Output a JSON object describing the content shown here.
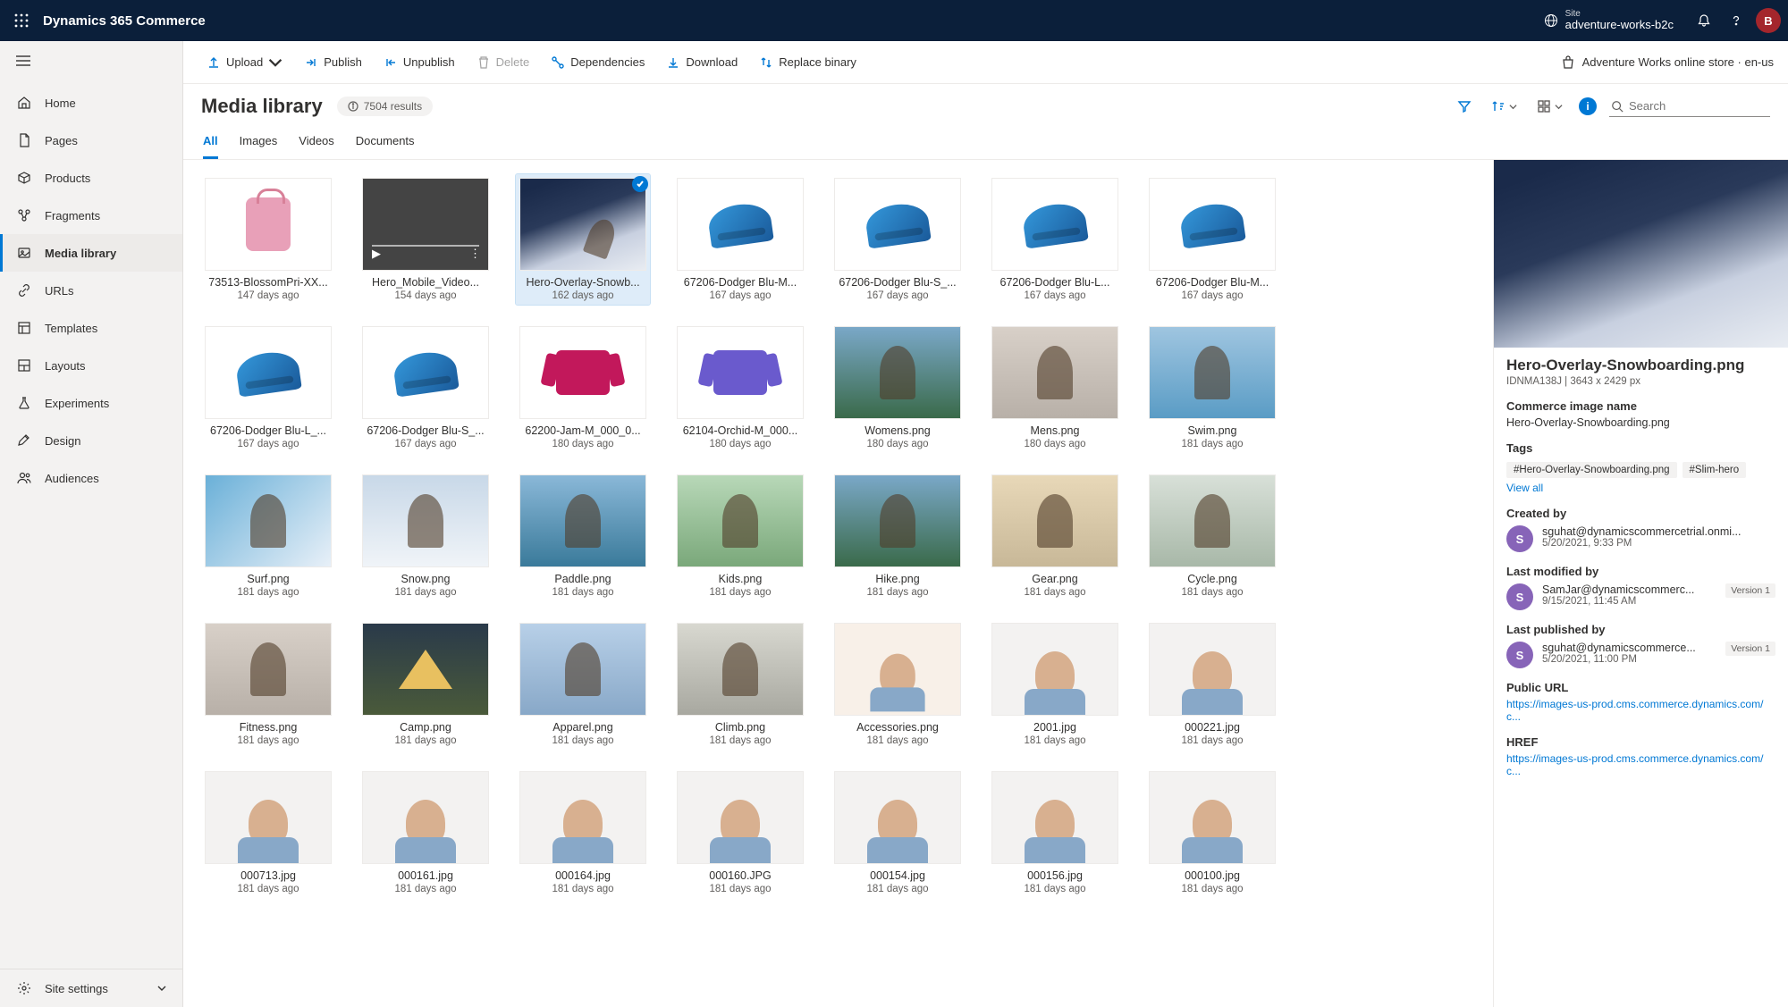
{
  "topbar": {
    "app_title": "Dynamics 365 Commerce",
    "site_label": "Site",
    "site_name": "adventure-works-b2c",
    "avatar_initial": "B"
  },
  "sidebar": {
    "items": [
      {
        "label": "Home",
        "icon": "home"
      },
      {
        "label": "Pages",
        "icon": "page"
      },
      {
        "label": "Products",
        "icon": "product"
      },
      {
        "label": "Fragments",
        "icon": "fragment"
      },
      {
        "label": "Media library",
        "icon": "media",
        "active": true
      },
      {
        "label": "URLs",
        "icon": "link"
      },
      {
        "label": "Templates",
        "icon": "template"
      },
      {
        "label": "Layouts",
        "icon": "layout"
      },
      {
        "label": "Experiments",
        "icon": "flask"
      },
      {
        "label": "Design",
        "icon": "design"
      },
      {
        "label": "Audiences",
        "icon": "people"
      }
    ],
    "settings_label": "Site settings"
  },
  "cmdbar": {
    "upload": "Upload",
    "publish": "Publish",
    "unpublish": "Unpublish",
    "delete": "Delete",
    "dependencies": "Dependencies",
    "download": "Download",
    "replace": "Replace binary",
    "context": "Adventure Works online store · en-us"
  },
  "page": {
    "title": "Media library",
    "count": "7504 results",
    "search_placeholder": "Search"
  },
  "tabs": [
    "All",
    "Images",
    "Videos",
    "Documents"
  ],
  "items": [
    {
      "name": "73513-BlossomPri-XX...",
      "age": "147 days ago",
      "t": "bag"
    },
    {
      "name": "Hero_Mobile_Video...",
      "age": "154 days ago",
      "t": "video"
    },
    {
      "name": "Hero-Overlay-Snowb...",
      "age": "162 days ago",
      "t": "hero",
      "selected": true
    },
    {
      "name": "67206-Dodger Blu-M...",
      "age": "167 days ago",
      "t": "helmet"
    },
    {
      "name": "67206-Dodger Blu-S_...",
      "age": "167 days ago",
      "t": "helmet"
    },
    {
      "name": "67206-Dodger Blu-L...",
      "age": "167 days ago",
      "t": "helmet"
    },
    {
      "name": "67206-Dodger Blu-M...",
      "age": "167 days ago",
      "t": "helmet"
    },
    {
      "name": "67206-Dodger Blu-L_...",
      "age": "167 days ago",
      "t": "helmet"
    },
    {
      "name": "67206-Dodger Blu-S_...",
      "age": "167 days ago",
      "t": "helmet"
    },
    {
      "name": "62200-Jam-M_000_0...",
      "age": "180 days ago",
      "t": "jacket"
    },
    {
      "name": "62104-Orchid-M_000...",
      "age": "180 days ago",
      "t": "jacketp"
    },
    {
      "name": "Womens.png",
      "age": "180 days ago",
      "t": "hike"
    },
    {
      "name": "Mens.png",
      "age": "180 days ago",
      "t": "person-out"
    },
    {
      "name": "Swim.png",
      "age": "181 days ago",
      "t": "swim"
    },
    {
      "name": "Surf.png",
      "age": "181 days ago",
      "t": "surf"
    },
    {
      "name": "Snow.png",
      "age": "181 days ago",
      "t": "snow"
    },
    {
      "name": "Paddle.png",
      "age": "181 days ago",
      "t": "paddle"
    },
    {
      "name": "Kids.png",
      "age": "181 days ago",
      "t": "kids"
    },
    {
      "name": "Hike.png",
      "age": "181 days ago",
      "t": "hike"
    },
    {
      "name": "Gear.png",
      "age": "181 days ago",
      "t": "gear"
    },
    {
      "name": "Cycle.png",
      "age": "181 days ago",
      "t": "cycle"
    },
    {
      "name": "Fitness.png",
      "age": "181 days ago",
      "t": "fitness"
    },
    {
      "name": "Camp.png",
      "age": "181 days ago",
      "t": "camp"
    },
    {
      "name": "Apparel.png",
      "age": "181 days ago",
      "t": "apparel"
    },
    {
      "name": "Climb.png",
      "age": "181 days ago",
      "t": "climb"
    },
    {
      "name": "Accessories.png",
      "age": "181 days ago",
      "t": "access"
    },
    {
      "name": "2001.jpg",
      "age": "181 days ago",
      "t": "person"
    },
    {
      "name": "000221.jpg",
      "age": "181 days ago",
      "t": "person"
    },
    {
      "name": "000713.jpg",
      "age": "181 days ago",
      "t": "person"
    },
    {
      "name": "000161.jpg",
      "age": "181 days ago",
      "t": "person"
    },
    {
      "name": "000164.jpg",
      "age": "181 days ago",
      "t": "person"
    },
    {
      "name": "000160.JPG",
      "age": "181 days ago",
      "t": "person"
    },
    {
      "name": "000154.jpg",
      "age": "181 days ago",
      "t": "person"
    },
    {
      "name": "000156.jpg",
      "age": "181 days ago",
      "t": "person"
    },
    {
      "name": "000100.jpg",
      "age": "181 days ago",
      "t": "person"
    }
  ],
  "details": {
    "title": "Hero-Overlay-Snowboarding.png",
    "subtitle": "IDNMA138J | 3643 x 2429 px",
    "image_name_label": "Commerce image name",
    "image_name": "Hero-Overlay-Snowboarding.png",
    "tags_label": "Tags",
    "tags": [
      "#Hero-Overlay-Snowboarding.png",
      "#Slim-hero"
    ],
    "view_all": "View all",
    "created_label": "Created by",
    "created_user": "sguhat@dynamicscommercetrial.onmi...",
    "created_date": "5/20/2021, 9:33 PM",
    "modified_label": "Last modified by",
    "modified_user": "SamJar@dynamicscommerc...",
    "modified_date": "9/15/2021, 11:45 AM",
    "modified_version": "Version 1",
    "published_label": "Last published by",
    "published_user": "sguhat@dynamicscommerce...",
    "published_date": "5/20/2021, 11:00 PM",
    "published_version": "Version 1",
    "public_url_label": "Public URL",
    "public_url": "https://images-us-prod.cms.commerce.dynamics.com/c...",
    "href_label": "HREF",
    "href": "https://images-us-prod.cms.commerce.dynamics.com/c..."
  }
}
